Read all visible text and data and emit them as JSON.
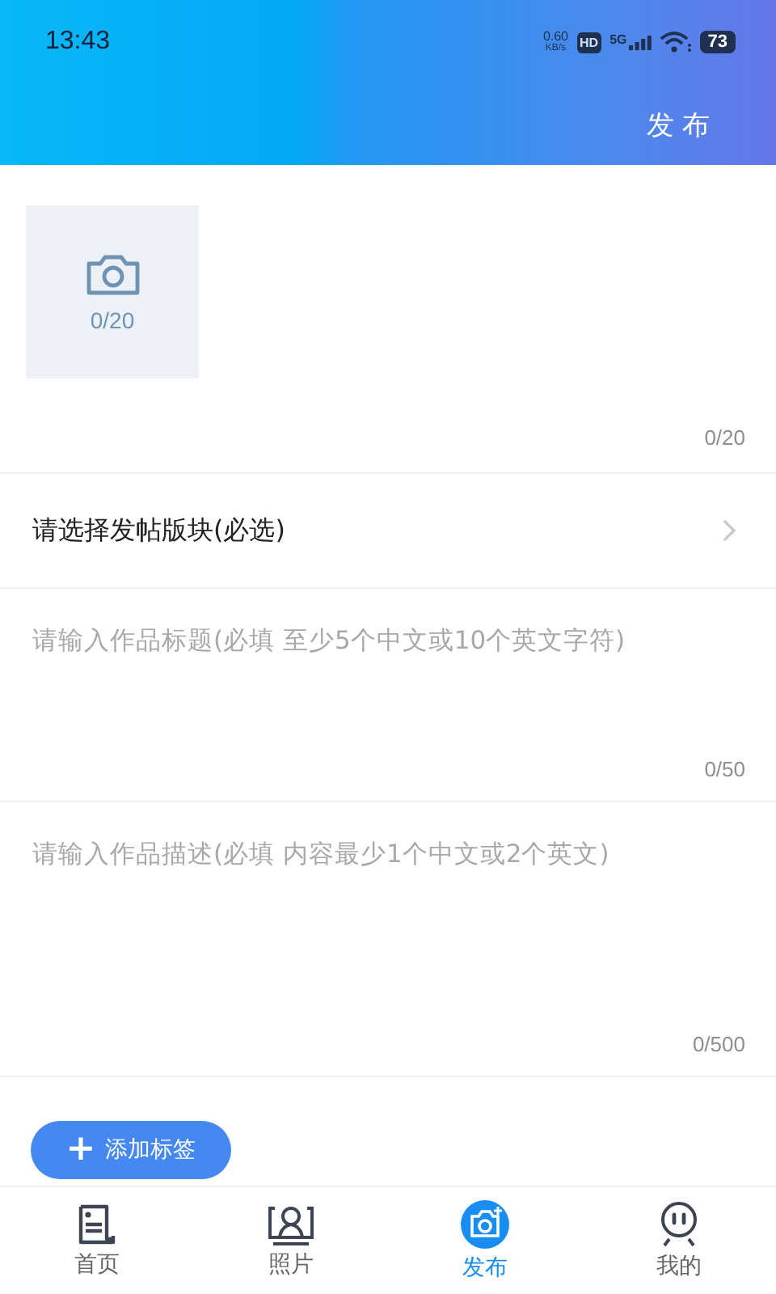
{
  "status_bar": {
    "time": "13:43",
    "speed": "0.60",
    "speed_unit": "KB/s",
    "hd": "HD",
    "network": "5G",
    "battery": "73"
  },
  "header": {
    "action": "发布"
  },
  "photos": {
    "count": "0/20",
    "counter": "0/20"
  },
  "section_picker": {
    "label": "请选择发帖版块(必选)"
  },
  "title_field": {
    "placeholder": "请输入作品标题(必填 至少5个中文或10个英文字符)",
    "counter": "0/50"
  },
  "description_field": {
    "placeholder": "请输入作品描述(必填 内容最少1个中文或2个英文)",
    "counter": "0/500"
  },
  "add_tag_button": {
    "icon": "+",
    "label": "添加标签"
  },
  "tab_bar": [
    {
      "kind": "home",
      "label": "首页",
      "selected": false
    },
    {
      "kind": "photo",
      "label": "照片",
      "selected": false
    },
    {
      "kind": "publish",
      "label": "发布",
      "selected": true
    },
    {
      "kind": "me",
      "label": "我的",
      "selected": false
    }
  ]
}
